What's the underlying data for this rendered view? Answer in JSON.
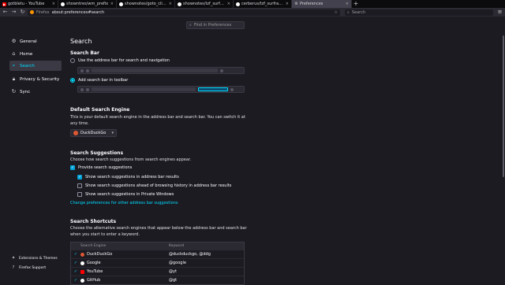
{
  "tabs": [
    {
      "label": "gotbletu - YouTube",
      "icon_color": "#ff0000",
      "icon": "youtube-icon"
    },
    {
      "label": "showntres/wm_prefix",
      "icon_color": "#ffffff",
      "icon": "github-icon"
    },
    {
      "label": "shownotes/goto_clipbo",
      "icon_color": "#ffffff",
      "icon": "github-icon"
    },
    {
      "label": "shownotes/tzf_surfraw.n",
      "icon_color": "#ffffff",
      "icon": "github-icon"
    },
    {
      "label": "cerberus/tzf_surfraw.cp",
      "icon_color": "#ffffff",
      "icon": "github-icon"
    },
    {
      "label": "Preferences",
      "icon_color": "#cccccc",
      "icon": "gear-icon",
      "active": true
    }
  ],
  "newtab_label": "+",
  "navbar": {
    "identity": "Firefox",
    "url": "about:preferences#search",
    "search_placeholder": "Search"
  },
  "sidebar": {
    "items": [
      {
        "label": "General",
        "icon": "gear-icon"
      },
      {
        "label": "Home",
        "icon": "home-icon"
      },
      {
        "label": "Search",
        "icon": "search-icon",
        "active": true
      },
      {
        "label": "Privacy & Security",
        "icon": "lock-icon"
      },
      {
        "label": "Sync",
        "icon": "sync-icon"
      }
    ],
    "footer": [
      {
        "label": "Extensions & Themes",
        "icon": "puzzle-icon"
      },
      {
        "label": "Firefox Support",
        "icon": "help-icon"
      }
    ]
  },
  "find_placeholder": "Find in Preferences",
  "page_title": "Search",
  "search_bar": {
    "heading": "Search Bar",
    "option_address": "Use the address bar for search and navigation",
    "option_toolbar": "Add search bar in toolbar",
    "selected": "toolbar"
  },
  "default_engine": {
    "heading": "Default Search Engine",
    "description": "This is your default search engine in the address bar and search bar. You can switch it at any time.",
    "selected": "DuckDuckGo"
  },
  "suggestions": {
    "heading": "Search Suggestions",
    "description": "Choose how search suggestions from search engines appear.",
    "provide": {
      "label": "Provide search suggestions",
      "checked": true
    },
    "in_address_bar": {
      "label": "Show search suggestions in address bar results",
      "checked": true
    },
    "ahead_of_history": {
      "label": "Show search suggestions ahead of browsing history in address bar results",
      "checked": false
    },
    "private_windows": {
      "label": "Show search suggestions in Private Windows",
      "checked": false
    },
    "link": "Change preferences for other address bar suggestions"
  },
  "shortcuts": {
    "heading": "Search Shortcuts",
    "description": "Choose the alternative search engines that appear below the address bar and search bar when you start to enter a keyword.",
    "col_engine": "Search Engine",
    "col_keyword": "Keyword",
    "rows": [
      {
        "engine": "DuckDuckGo",
        "keyword": "@duckduckgo, @ddg",
        "color": "#de5833"
      },
      {
        "engine": "Google",
        "keyword": "@google",
        "color": "#ffffff"
      },
      {
        "engine": "YouTube",
        "keyword": "@yt",
        "color": "#ff0000"
      },
      {
        "engine": "GitHub",
        "keyword": "@gt",
        "color": "#ffffff"
      }
    ]
  }
}
